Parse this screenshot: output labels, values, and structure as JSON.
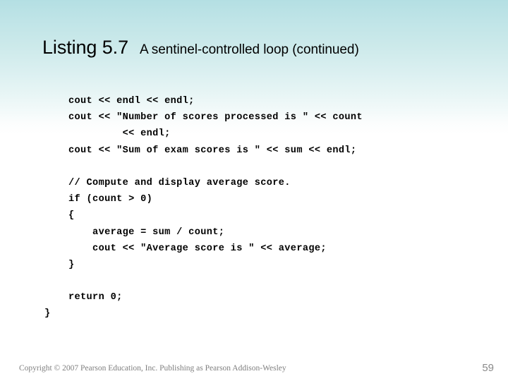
{
  "slide": {
    "title_main": "Listing 5.7",
    "title_sub": "A sentinel-controlled loop (continued)",
    "background_top_color": "#b4dfe3",
    "background_bottom_color": "#ffffff"
  },
  "code": {
    "lines": [
      "    cout << endl << endl;",
      "    cout << \"Number of scores processed is \" << count",
      "             << endl;",
      "    cout << \"Sum of exam scores is \" << sum << endl;",
      "",
      "    // Compute and display average score.",
      "    if (count > 0)",
      "    {",
      "        average = sum / count;",
      "        cout << \"Average score is \" << average;",
      "    }",
      "",
      "    return 0;",
      "}"
    ]
  },
  "footer": {
    "copyright": "Copyright © 2007 Pearson Education, Inc. Publishing as Pearson Addison-Wesley",
    "page_number": "59"
  }
}
